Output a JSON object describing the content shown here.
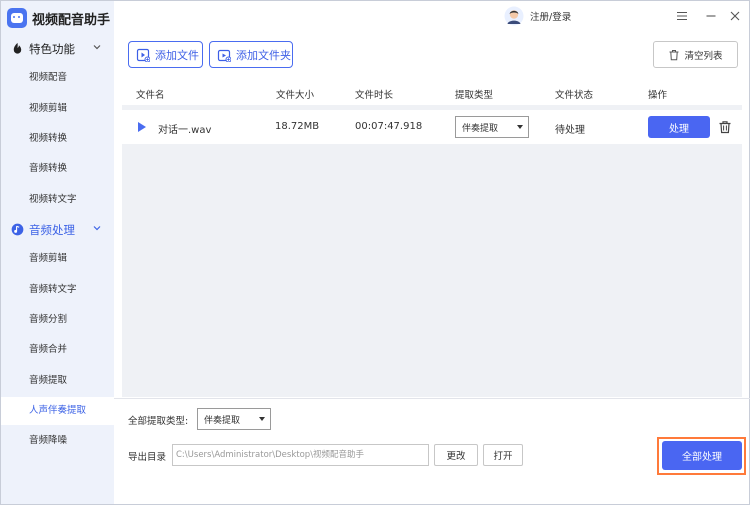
{
  "app": {
    "title": "视频配音助手"
  },
  "header": {
    "login_label": "注册/登录",
    "menu_icon": "menu-icon",
    "minimize_icon": "minimize-icon",
    "close_icon": "close-icon"
  },
  "sidebar": {
    "groups": [
      {
        "label": "特色功能",
        "icon": "feature-icon",
        "items": [
          "视频配音",
          "视频剪辑",
          "视频转换",
          "音频转换",
          "视频转文字"
        ]
      },
      {
        "label": "音频处理",
        "icon": "audio-icon",
        "items": [
          "音频剪辑",
          "音频转文字",
          "音频分割",
          "音频合并",
          "音频提取",
          "人声伴奏提取",
          "音频降噪"
        ]
      }
    ],
    "selected": "人声伴奏提取"
  },
  "toolbar": {
    "add_file": "添加文件",
    "add_folder": "添加文件夹",
    "clear_list": "清空列表"
  },
  "table": {
    "headers": [
      "文件名",
      "文件大小",
      "文件时长",
      "提取类型",
      "文件状态",
      "操作"
    ],
    "rows": [
      {
        "name": "对话一.wav",
        "size": "18.72MB",
        "duration": "00:07:47.918",
        "type": "伴奏提取",
        "status": "待处理",
        "action": "处理"
      }
    ]
  },
  "footer": {
    "extract_type_label": "全部提取类型:",
    "extract_type_value": "伴奏提取",
    "output_dir_label": "导出目录",
    "output_dir_value": "C:\\Users\\Administrator\\Desktop\\视频配音助手",
    "change_label": "更改",
    "open_label": "打开",
    "process_all_label": "全部处理"
  },
  "colors": {
    "accent": "#4a66f2",
    "sidebar_bg": "#eef2fb",
    "highlight": "#ff7a3a"
  }
}
